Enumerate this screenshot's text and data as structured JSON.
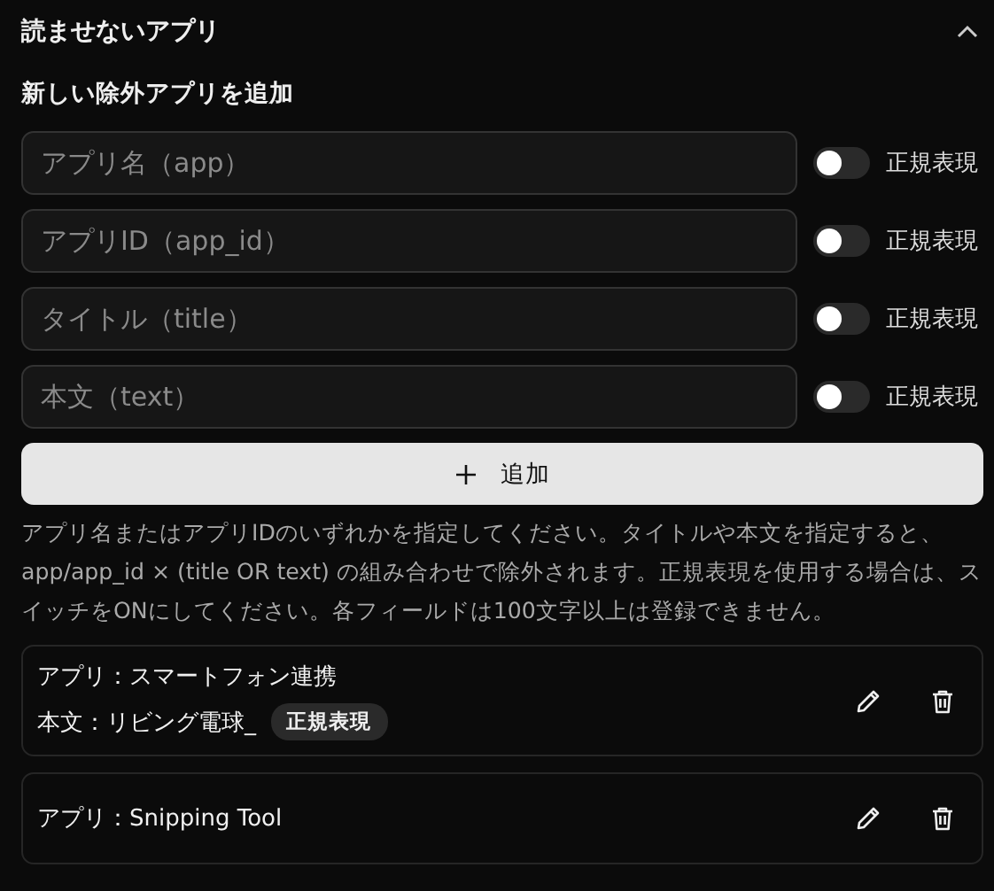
{
  "section": {
    "title": "読ませないアプリ",
    "expanded": true
  },
  "form": {
    "title": "新しい除外アプリを追加",
    "fields": [
      {
        "placeholder": "アプリ名（app）",
        "regex_label": "正規表現",
        "regex_on": false
      },
      {
        "placeholder": "アプリID（app_id）",
        "regex_label": "正規表現",
        "regex_on": false
      },
      {
        "placeholder": "タイトル（title）",
        "regex_label": "正規表現",
        "regex_on": false
      },
      {
        "placeholder": "本文（text）",
        "regex_label": "正規表現",
        "regex_on": false
      }
    ],
    "add_button": "追加",
    "help": "アプリ名またはアプリIDのいずれかを指定してください。タイトルや本文を指定すると、app/app_id × (title OR text) の組み合わせで除外されます。正規表現を使用する場合は、スイッチをONにしてください。各フィールドは100文字以上は登録できません。"
  },
  "rules": [
    {
      "lines": [
        {
          "text": "アプリ：スマートフォン連携"
        },
        {
          "text": "本文：リビング電球_",
          "badge": "正規表現"
        }
      ]
    },
    {
      "lines": [
        {
          "text": "アプリ：Snipping Tool"
        }
      ]
    }
  ]
}
